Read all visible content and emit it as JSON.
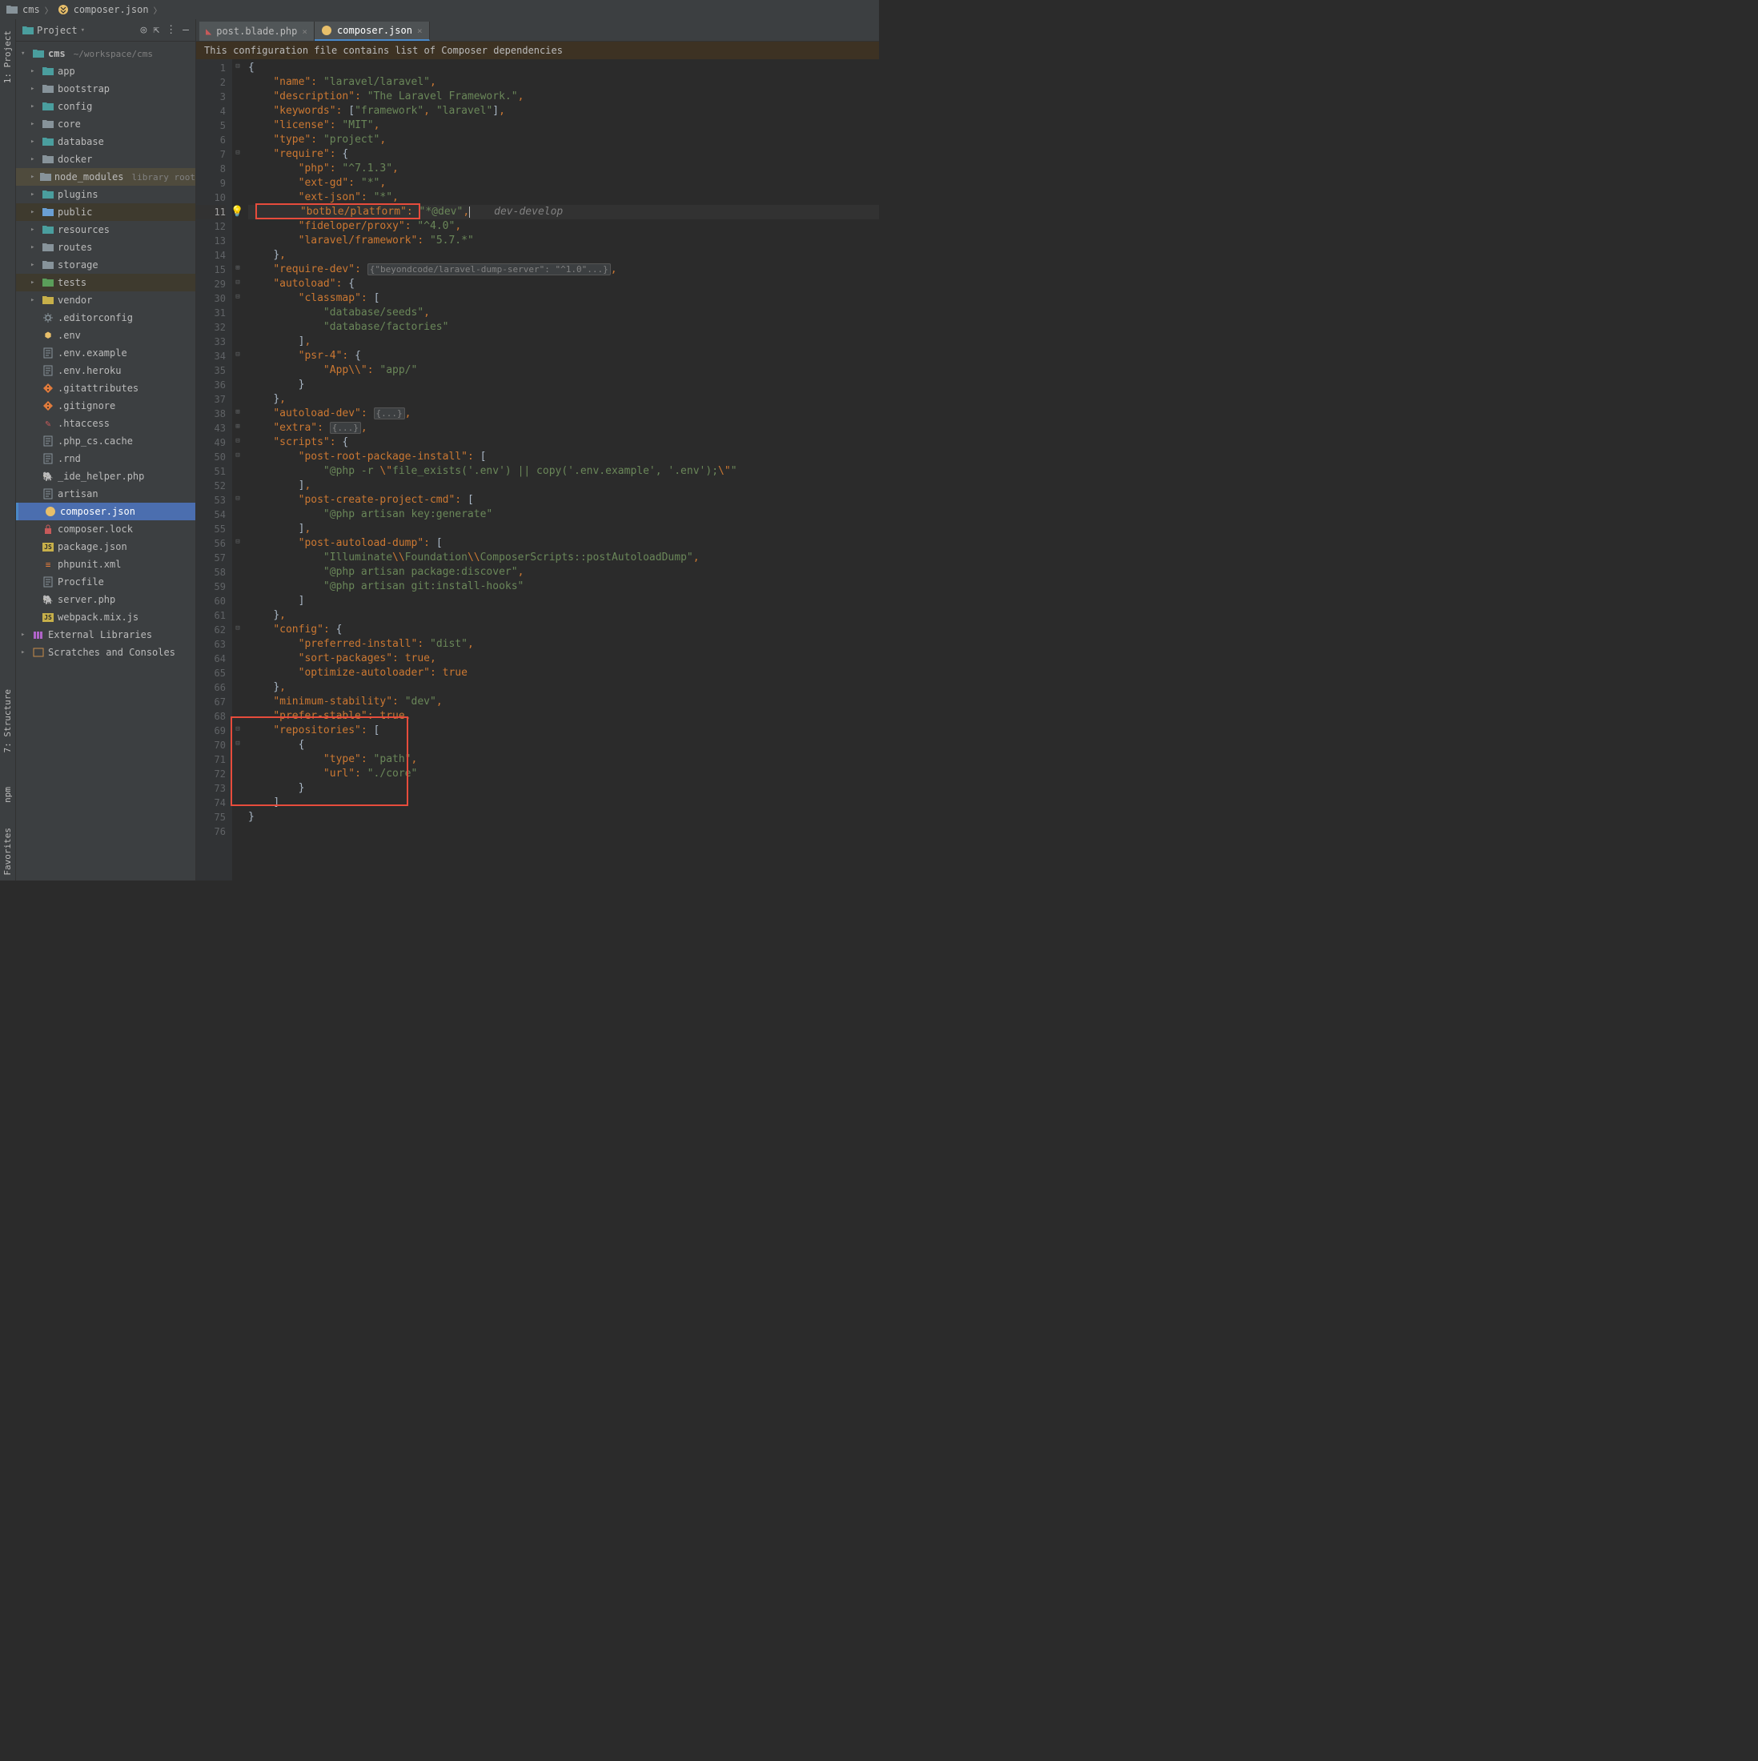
{
  "breadcrumb": {
    "items": [
      "cms",
      "composer.json"
    ]
  },
  "sidebar": {
    "header": {
      "label": "Project"
    },
    "root": {
      "name": "cms",
      "path": "~/workspace/cms"
    },
    "folders": [
      {
        "name": "app",
        "color": "teal"
      },
      {
        "name": "bootstrap",
        "color": ""
      },
      {
        "name": "config",
        "color": "teal"
      },
      {
        "name": "core",
        "color": ""
      },
      {
        "name": "database",
        "color": "teal"
      },
      {
        "name": "docker",
        "color": ""
      },
      {
        "name": "node_modules",
        "suffix": "library root",
        "highlight": true
      },
      {
        "name": "plugins",
        "color": "teal"
      },
      {
        "name": "public",
        "color": "blue",
        "highlight2": true
      },
      {
        "name": "resources",
        "color": "teal"
      },
      {
        "name": "routes",
        "color": ""
      },
      {
        "name": "storage",
        "color": ""
      },
      {
        "name": "tests",
        "color": "green",
        "highlight2": true
      },
      {
        "name": "vendor",
        "color": "yellow"
      }
    ],
    "files": [
      {
        "name": ".editorconfig",
        "icon": "gear"
      },
      {
        "name": ".env",
        "icon": "env"
      },
      {
        "name": ".env.example",
        "icon": "txt"
      },
      {
        "name": ".env.heroku",
        "icon": "txt"
      },
      {
        "name": ".gitattributes",
        "icon": "git"
      },
      {
        "name": ".gitignore",
        "icon": "git"
      },
      {
        "name": ".htaccess",
        "icon": "htaccess"
      },
      {
        "name": ".php_cs.cache",
        "icon": "txt"
      },
      {
        "name": ".rnd",
        "icon": "txt"
      },
      {
        "name": "_ide_helper.php",
        "icon": "php"
      },
      {
        "name": "artisan",
        "icon": "txt"
      },
      {
        "name": "composer.json",
        "icon": "json",
        "selected": true
      },
      {
        "name": "composer.lock",
        "icon": "lock"
      },
      {
        "name": "package.json",
        "icon": "js"
      },
      {
        "name": "phpunit.xml",
        "icon": "xml"
      },
      {
        "name": "Procfile",
        "icon": "txt"
      },
      {
        "name": "server.php",
        "icon": "php"
      },
      {
        "name": "webpack.mix.js",
        "icon": "js2"
      }
    ],
    "bottom": [
      {
        "name": "External Libraries",
        "icon": "lib"
      },
      {
        "name": "Scratches and Consoles",
        "icon": "scratch"
      }
    ]
  },
  "left_tabs": {
    "project": "1: Project",
    "structure": "7: Structure",
    "npm": "npm",
    "favorites": "Favorites"
  },
  "editor_tabs": [
    {
      "label": "post.blade.php",
      "icon": "blade",
      "active": false
    },
    {
      "label": "composer.json",
      "icon": "json",
      "active": true
    }
  ],
  "banner": "This configuration file contains list of Composer dependencies",
  "code": {
    "lines": [
      {
        "n": 1,
        "t": "{",
        "fold": "-"
      },
      {
        "n": 2,
        "t": "    \"name\": \"laravel/laravel\","
      },
      {
        "n": 3,
        "t": "    \"description\": \"The Laravel Framework.\","
      },
      {
        "n": 4,
        "t": "    \"keywords\": [\"framework\", \"laravel\"],"
      },
      {
        "n": 5,
        "t": "    \"license\": \"MIT\","
      },
      {
        "n": 6,
        "t": "    \"type\": \"project\","
      },
      {
        "n": 7,
        "t": "    \"require\": {",
        "fold": "-"
      },
      {
        "n": 8,
        "t": "        \"php\": \"^7.1.3\","
      },
      {
        "n": 9,
        "t": "        \"ext-gd\": \"*\","
      },
      {
        "n": 10,
        "t": "        \"ext-json\": \"*\","
      },
      {
        "n": 11,
        "t": "        \"botble/platform\": \"*@dev\",",
        "hl": true,
        "hint": "dev-develop"
      },
      {
        "n": 12,
        "t": "        \"fideloper/proxy\": \"^4.0\","
      },
      {
        "n": 13,
        "t": "        \"laravel/framework\": \"5.7.*\""
      },
      {
        "n": 14,
        "t": "    },"
      },
      {
        "n": 15,
        "t": "    \"require-dev\": {\"beyondcode/laravel-dump-server\": \"^1.0\"...},",
        "folded": true
      },
      {
        "n": 29,
        "t": "    \"autoload\": {",
        "fold": "-"
      },
      {
        "n": 30,
        "t": "        \"classmap\": [",
        "fold": "-"
      },
      {
        "n": 31,
        "t": "            \"database/seeds\","
      },
      {
        "n": 32,
        "t": "            \"database/factories\""
      },
      {
        "n": 33,
        "t": "        ],"
      },
      {
        "n": 34,
        "t": "        \"psr-4\": {",
        "fold": "-"
      },
      {
        "n": 35,
        "t": "            \"App\\\\\": \"app/\""
      },
      {
        "n": 36,
        "t": "        }"
      },
      {
        "n": 37,
        "t": "    },"
      },
      {
        "n": 38,
        "t": "    \"autoload-dev\": {...},",
        "folded": true
      },
      {
        "n": 43,
        "t": "    \"extra\": {...},",
        "folded": true
      },
      {
        "n": 49,
        "t": "    \"scripts\": {",
        "fold": "-"
      },
      {
        "n": 50,
        "t": "        \"post-root-package-install\": [",
        "fold": "-"
      },
      {
        "n": 51,
        "t": "            \"@php -r \\\"file_exists('.env') || copy('.env.example', '.env');\\\"\""
      },
      {
        "n": 52,
        "t": "        ],"
      },
      {
        "n": 53,
        "t": "        \"post-create-project-cmd\": [",
        "fold": "-"
      },
      {
        "n": 54,
        "t": "            \"@php artisan key:generate\""
      },
      {
        "n": 55,
        "t": "        ],"
      },
      {
        "n": 56,
        "t": "        \"post-autoload-dump\": [",
        "fold": "-"
      },
      {
        "n": 57,
        "t": "            \"Illuminate\\\\Foundation\\\\ComposerScripts::postAutoloadDump\","
      },
      {
        "n": 58,
        "t": "            \"@php artisan package:discover\","
      },
      {
        "n": 59,
        "t": "            \"@php artisan git:install-hooks\""
      },
      {
        "n": 60,
        "t": "        ]"
      },
      {
        "n": 61,
        "t": "    },"
      },
      {
        "n": 62,
        "t": "    \"config\": {",
        "fold": "-"
      },
      {
        "n": 63,
        "t": "        \"preferred-install\": \"dist\","
      },
      {
        "n": 64,
        "t": "        \"sort-packages\": true,"
      },
      {
        "n": 65,
        "t": "        \"optimize-autoloader\": true"
      },
      {
        "n": 66,
        "t": "    },"
      },
      {
        "n": 67,
        "t": "    \"minimum-stability\": \"dev\","
      },
      {
        "n": 68,
        "t": "    \"prefer-stable\": true,"
      },
      {
        "n": 69,
        "t": "    \"repositories\": [",
        "fold": "-"
      },
      {
        "n": 70,
        "t": "        {",
        "fold": "-"
      },
      {
        "n": 71,
        "t": "            \"type\": \"path\","
      },
      {
        "n": 72,
        "t": "            \"url\": \"./core\""
      },
      {
        "n": 73,
        "t": "        }"
      },
      {
        "n": 74,
        "t": "    ]"
      },
      {
        "n": 75,
        "t": "}"
      },
      {
        "n": 76,
        "t": ""
      }
    ]
  }
}
